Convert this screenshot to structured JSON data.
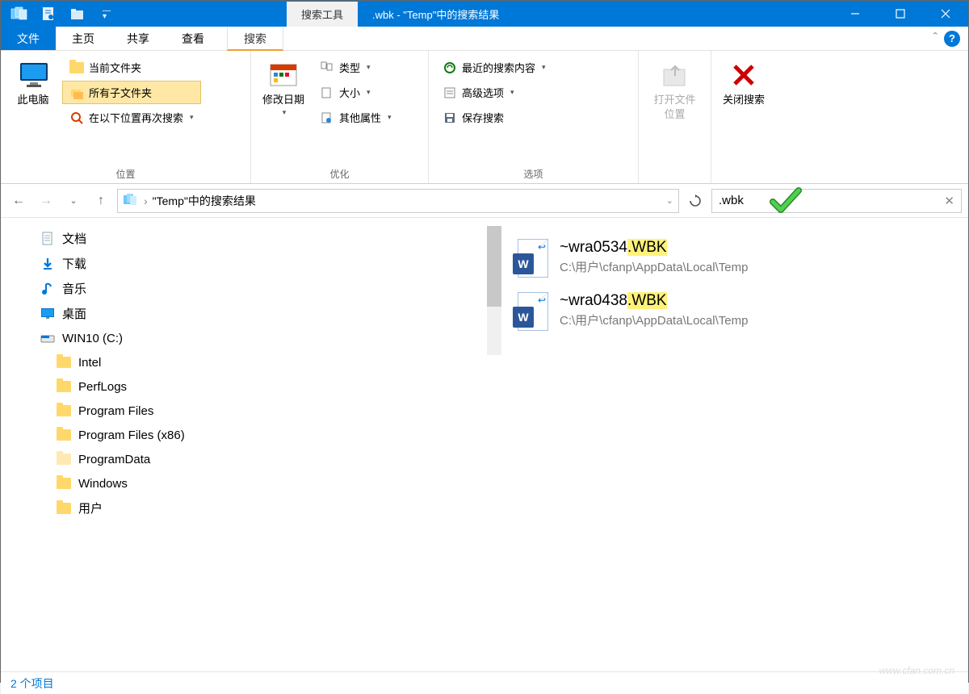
{
  "titlebar": {
    "contextual_tab": "搜索工具",
    "title": ".wbk - \"Temp\"中的搜索结果"
  },
  "tabs": {
    "file": "文件",
    "home": "主页",
    "share": "共享",
    "view": "查看",
    "search": "搜索"
  },
  "ribbon": {
    "this_pc": "此电脑",
    "current_folder": "当前文件夹",
    "all_subfolders": "所有子文件夹",
    "search_again": "在以下位置再次搜索",
    "group_location": "位置",
    "modify_date": "修改日期",
    "type": "类型",
    "size": "大小",
    "other_props": "其他属性",
    "group_refine": "优化",
    "recent": "最近的搜索内容",
    "advanced": "高级选项",
    "save_search": "保存搜索",
    "group_options": "选项",
    "open_location": "打开文件位置",
    "close_search": "关闭搜索"
  },
  "nav": {
    "breadcrumb": "\"Temp\"中的搜索结果",
    "search_value": ".wbk"
  },
  "tree": {
    "documents": "文档",
    "downloads": "下载",
    "music": "音乐",
    "desktop": "桌面",
    "drive": "WIN10 (C:)",
    "folders": [
      "Intel",
      "PerfLogs",
      "Program Files",
      "Program Files (x86)",
      "ProgramData",
      "Windows",
      "用户"
    ]
  },
  "results": [
    {
      "name_prefix": "~wra0534",
      "name_ext": ".WBK",
      "path": "C:\\用户\\cfanp\\AppData\\Local\\Temp"
    },
    {
      "name_prefix": "~wra0438",
      "name_ext": ".WBK",
      "path": "C:\\用户\\cfanp\\AppData\\Local\\Temp"
    }
  ],
  "status": {
    "items": "2 个项目"
  },
  "watermark": "www.cfan.com.cn"
}
